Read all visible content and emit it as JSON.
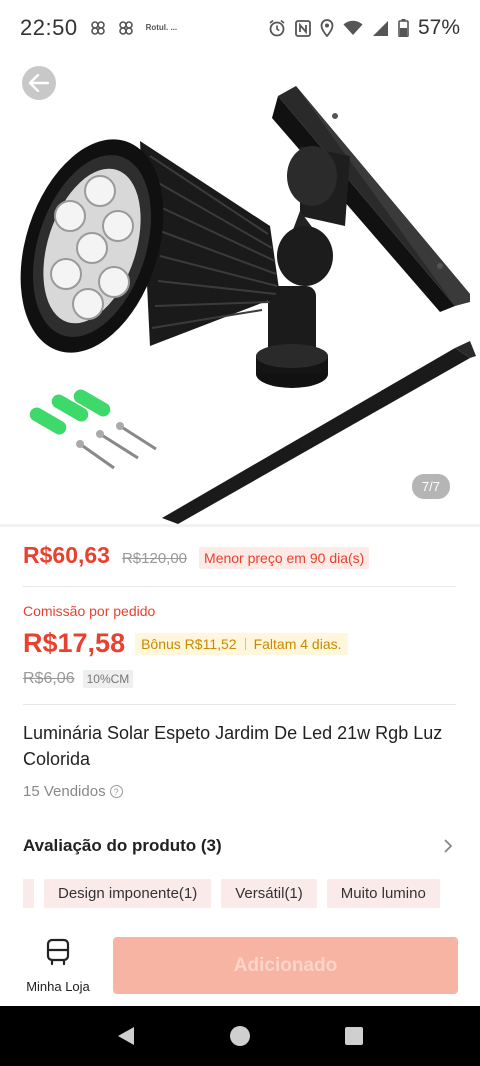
{
  "status_bar": {
    "time": "22:50",
    "battery": "57%",
    "logo_text": "Rotul. ..."
  },
  "gallery": {
    "counter": "7/7"
  },
  "price": {
    "current": "R$60,63",
    "original": "R$120,00",
    "lowest_tag": "Menor preço em 90 dia(s)"
  },
  "commission": {
    "label": "Comissão por pedido",
    "value": "R$17,58",
    "bonus": "Bônus R$11,52",
    "days_left": "Faltam 4 dias.",
    "old_value": "R$6,06",
    "rate_tag": "10%CM"
  },
  "product": {
    "title": "Luminária Solar Espeto Jardim De Led 21w Rgb Luz Colorida",
    "sold": "15 Vendidos"
  },
  "reviews": {
    "title": "Avaliação do produto (3)",
    "tags": [
      "Design imponente(1)",
      "Versátil(1)",
      "Muito lumino"
    ]
  },
  "bottom_bar": {
    "store_label": "Minha Loja",
    "add_label": "Adicionado"
  },
  "colors": {
    "accent": "#e8412e",
    "add_button": "#f7b4a3",
    "bonus_bg": "#fff7dc",
    "chip_bg": "#fbeaea"
  },
  "icons": [
    "back-arrow-icon",
    "help-icon",
    "chevron-right-icon",
    "store-icon",
    "nav-back-icon",
    "nav-home-icon",
    "nav-recents-icon"
  ]
}
